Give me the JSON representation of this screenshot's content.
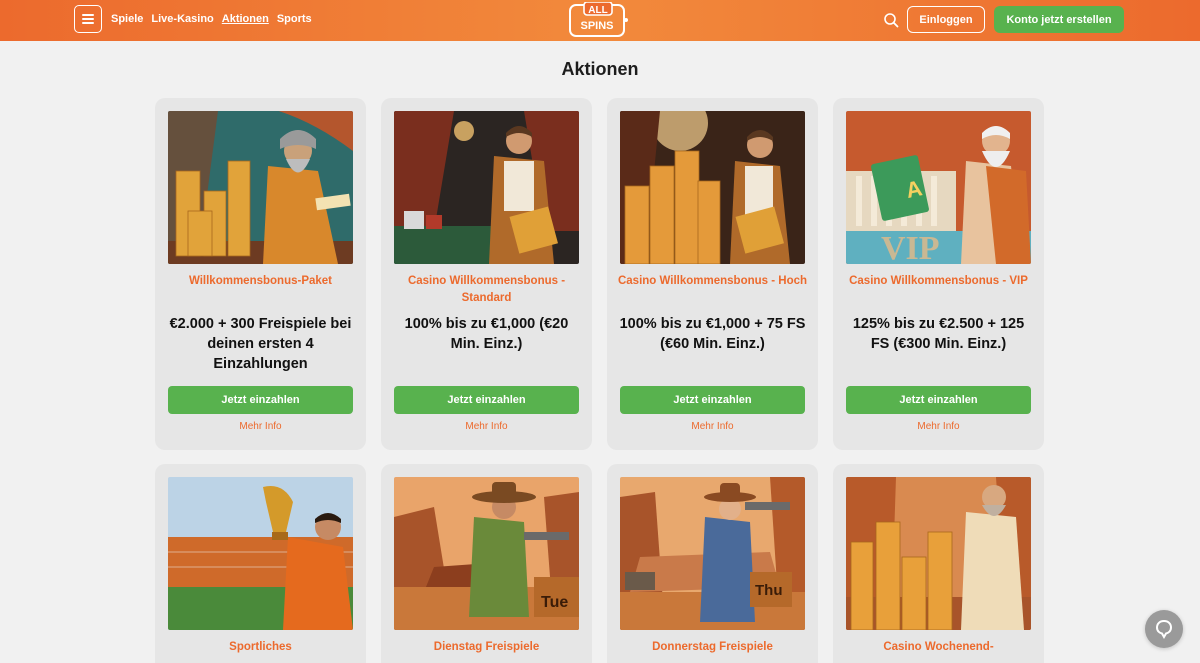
{
  "header": {
    "nav": [
      "Spiele",
      "Live-Kasino",
      "Aktionen",
      "Sports"
    ],
    "active_nav": "Aktionen",
    "logo_top": "ALL",
    "logo_bottom": "SPINS",
    "login_label": "Einloggen",
    "register_label": "Konto jetzt erstellen"
  },
  "page": {
    "title": "Aktionen"
  },
  "colors": {
    "accent": "#ec6a2d",
    "cta": "#58b24e",
    "card_bg": "#e6e6e6",
    "page_bg": "#f1f1f1"
  },
  "cards": [
    {
      "title": "Willkommensbonus-Paket",
      "offer": "€2.000 + 300 Freispiele bei deinen ersten 4 Einzahlungen",
      "cta": "Jetzt einzahlen",
      "more": "Mehr Info",
      "image": "wizard-with-coins"
    },
    {
      "title": "Casino Willkommensbonus - Standard",
      "offer": "100% bis zu €1,000 (€20 Min. Einz.)",
      "cta": "Jetzt einzahlen",
      "more": "Mehr Info",
      "image": "croupier-casino-table"
    },
    {
      "title": "Casino Willkommensbonus - Hoch",
      "offer": "100% bis zu €1,000 + 75 FS (€60 Min. Einz.)",
      "cta": "Jetzt einzahlen",
      "more": "Mehr Info",
      "image": "croupier-coin-stacks"
    },
    {
      "title": "Casino Willkommensbonus - VIP",
      "offer": "125% bis zu €2.500 + 125 FS (€300 Min. Einz.)",
      "cta": "Jetzt einzahlen",
      "more": "Mehr Info",
      "image": "zeus-vip-card"
    },
    {
      "title": "Sportliches",
      "offer": "",
      "cta": "",
      "more": "",
      "image": "footballer-trophy"
    },
    {
      "title": "Dienstag Freispiele",
      "offer": "",
      "cta": "",
      "more": "",
      "image": "cowboy-tue-crate"
    },
    {
      "title": "Donnerstag Freispiele",
      "offer": "",
      "cta": "",
      "more": "",
      "image": "cowgirl-thu-crate"
    },
    {
      "title": "Casino Wochenend-",
      "offer": "",
      "cta": "",
      "more": "",
      "image": "greek-man-coins"
    }
  ],
  "image_labels": {
    "vip": "VIP",
    "card_letter": "A",
    "tue": "Tue",
    "thu": "Thu"
  },
  "chat": {
    "icon": "chat-bubble-icon"
  }
}
